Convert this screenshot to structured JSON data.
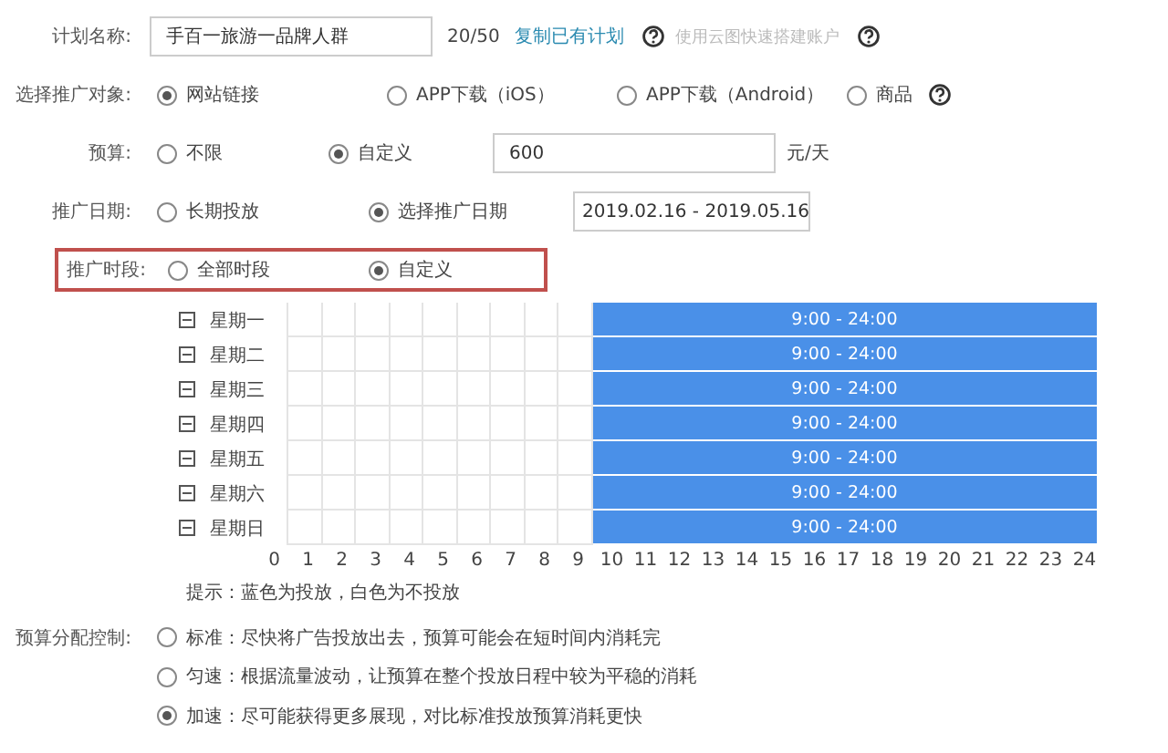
{
  "plan_name": {
    "label": "计划名称:",
    "value": "手百一旅游一品牌人群",
    "count": "20/50",
    "copy_link": "复制已有计划",
    "cloud_link": "使用云图快速搭建账户"
  },
  "target": {
    "label": "选择推广对象:",
    "options": [
      {
        "label": "网站链接",
        "selected": true
      },
      {
        "label": "APP下载（iOS）",
        "selected": false
      },
      {
        "label": "APP下载（Android）",
        "selected": false
      },
      {
        "label": "商品",
        "selected": false
      }
    ]
  },
  "budget": {
    "label": "预算:",
    "options": [
      {
        "label": "不限",
        "selected": false
      },
      {
        "label": "自定义",
        "selected": true
      }
    ],
    "value": "600",
    "unit": "元/天"
  },
  "date": {
    "label": "推广日期:",
    "options": [
      {
        "label": "长期投放",
        "selected": false
      },
      {
        "label": "选择推广日期",
        "selected": true
      }
    ],
    "range": "2019.02.16 - 2019.05.16"
  },
  "time": {
    "label": "推广时段:",
    "options": [
      {
        "label": "全部时段",
        "selected": false
      },
      {
        "label": "自定义",
        "selected": true
      }
    ]
  },
  "schedule": {
    "days": [
      {
        "label": "星期一",
        "slots": [
          {
            "selected": false
          },
          {
            "selected": false
          },
          {
            "selected": false
          },
          {
            "selected": false
          },
          {
            "selected": false
          },
          {
            "selected": false
          },
          {
            "selected": false
          },
          {
            "selected": false
          },
          {
            "selected": false
          },
          {
            "selected": true,
            "label": "9:00 - 24:00"
          }
        ]
      },
      {
        "label": "星期二",
        "slots": [
          {
            "selected": false
          },
          {
            "selected": false
          },
          {
            "selected": false
          },
          {
            "selected": false
          },
          {
            "selected": false
          },
          {
            "selected": false
          },
          {
            "selected": false
          },
          {
            "selected": false
          },
          {
            "selected": false
          },
          {
            "selected": true,
            "label": "9:00 - 24:00"
          }
        ]
      },
      {
        "label": "星期三",
        "slots": [
          {
            "selected": false
          },
          {
            "selected": false
          },
          {
            "selected": false
          },
          {
            "selected": false
          },
          {
            "selected": false
          },
          {
            "selected": false
          },
          {
            "selected": false
          },
          {
            "selected": false
          },
          {
            "selected": false
          },
          {
            "selected": true,
            "label": "9:00 - 24:00"
          }
        ]
      },
      {
        "label": "星期四",
        "slots": [
          {
            "selected": false
          },
          {
            "selected": false
          },
          {
            "selected": false
          },
          {
            "selected": false
          },
          {
            "selected": false
          },
          {
            "selected": false
          },
          {
            "selected": false
          },
          {
            "selected": false
          },
          {
            "selected": false
          },
          {
            "selected": true,
            "label": "9:00 - 24:00"
          }
        ]
      },
      {
        "label": "星期五",
        "slots": [
          {
            "selected": false
          },
          {
            "selected": false
          },
          {
            "selected": false
          },
          {
            "selected": false
          },
          {
            "selected": false
          },
          {
            "selected": false
          },
          {
            "selected": false
          },
          {
            "selected": false
          },
          {
            "selected": false
          },
          {
            "selected": true,
            "label": "9:00 - 24:00"
          }
        ]
      },
      {
        "label": "星期六",
        "slots": [
          {
            "selected": false
          },
          {
            "selected": false
          },
          {
            "selected": false
          },
          {
            "selected": false
          },
          {
            "selected": false
          },
          {
            "selected": false
          },
          {
            "selected": false
          },
          {
            "selected": false
          },
          {
            "selected": false
          },
          {
            "selected": true,
            "label": "9:00 - 24:00"
          }
        ]
      },
      {
        "label": "星期日",
        "slots": [
          {
            "selected": false
          },
          {
            "selected": false
          },
          {
            "selected": false
          },
          {
            "selected": false
          },
          {
            "selected": false
          },
          {
            "selected": false
          },
          {
            "selected": false
          },
          {
            "selected": false
          },
          {
            "selected": false
          },
          {
            "selected": true,
            "label": "9:00 - 24:00"
          }
        ]
      }
    ],
    "hours": [
      "0",
      "1",
      "2",
      "3",
      "4",
      "5",
      "6",
      "7",
      "8",
      "9",
      "10",
      "11",
      "12",
      "13",
      "14",
      "15",
      "16",
      "17",
      "18",
      "19",
      "20",
      "21",
      "22",
      "23",
      "24"
    ],
    "tip": "提示：蓝色为投放，白色为不投放"
  },
  "pacing": {
    "label": "预算分配控制:",
    "options": [
      {
        "label": "标准：尽快将广告投放出去，预算可能会在短时间内消耗完",
        "selected": false
      },
      {
        "label": "匀速：根据流量波动，让预算在整个投放日程中较为平稳的消耗",
        "selected": false
      },
      {
        "label": "加速：尽可能获得更多展现，对比标准投放预算消耗更快",
        "selected": true
      }
    ]
  }
}
